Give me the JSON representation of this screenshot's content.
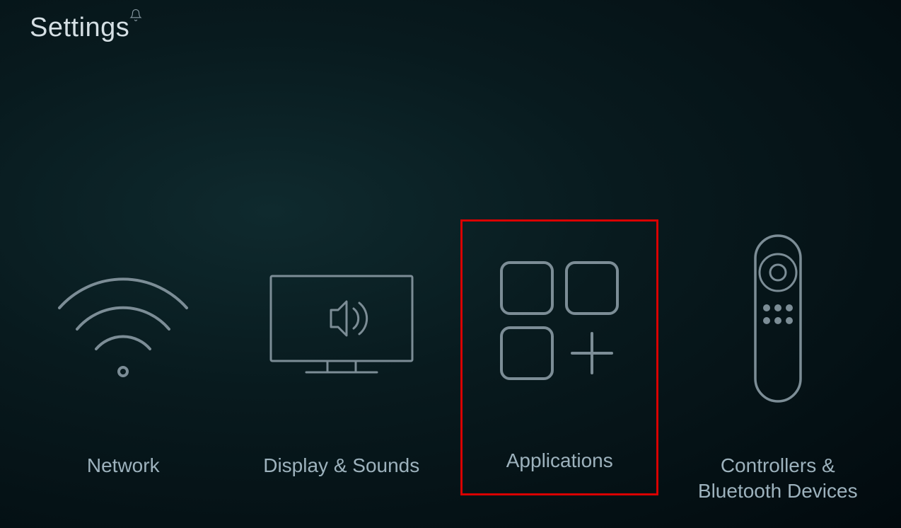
{
  "header": {
    "title": "Settings"
  },
  "tiles": [
    {
      "label": "Network"
    },
    {
      "label": "Display & Sounds"
    },
    {
      "label": "Applications"
    },
    {
      "label": "Controllers & Bluetooth Devices"
    }
  ]
}
